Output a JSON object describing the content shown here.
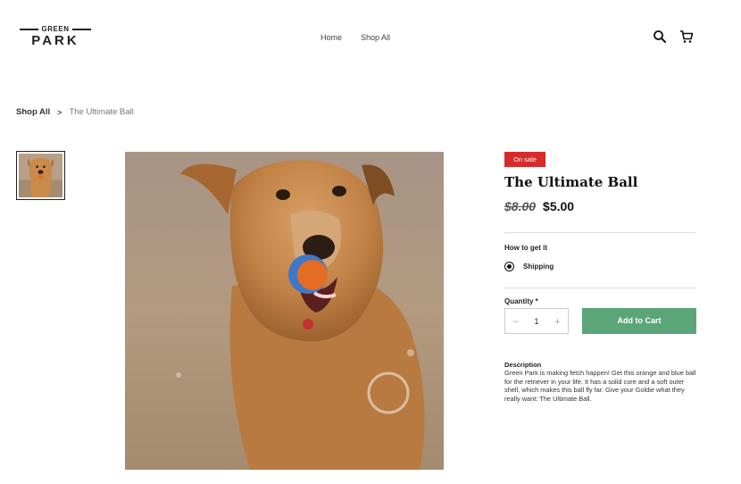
{
  "header": {
    "logo_top": "GREEN",
    "logo_main": "PARK",
    "nav": [
      "Home",
      "Shop All"
    ],
    "icons": [
      "search-icon",
      "cart-icon"
    ]
  },
  "breadcrumb": {
    "parent": "Shop All",
    "separator": ">",
    "current": "The Ultimate Ball"
  },
  "product": {
    "badge": "On sale",
    "title": "The Ultimate Ball",
    "old_price": "$8.00",
    "price": "$5.00",
    "how_to_get": "How to get it",
    "shipping_label": "Shipping",
    "quantity_label": "Quantity *",
    "quantity_value": "1",
    "add_to_cart": "Add to Cart",
    "description_title": "Description",
    "description": "Green Park is making fetch happen! Get this orange and blue ball for the retriever in your life. It has a solid core and a soft outer shell, which makes this ball fly far. Give your Goldie what they really want: The Ultimate Ball."
  },
  "colors": {
    "sale": "#d72b2b",
    "add_button": "#5ba679",
    "dog_fur": "#c98a4a",
    "sand": "#b39a80"
  }
}
